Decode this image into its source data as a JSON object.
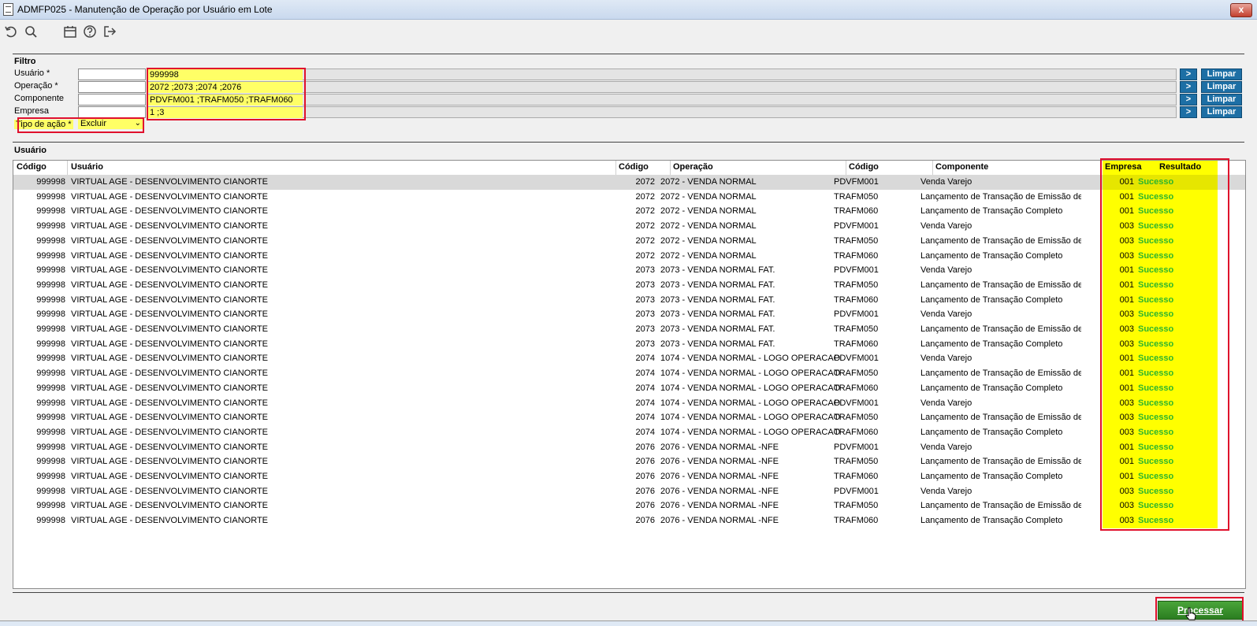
{
  "window": {
    "title": "ADMFP025 - Manutenção de Operação por Usuário em Lote",
    "close_label": "x"
  },
  "toolbar": {
    "icons": [
      "undo-icon",
      "search-icon",
      "calendar-icon",
      "help-icon",
      "exit-icon"
    ]
  },
  "filtro": {
    "section_label": "Filtro",
    "fields": [
      {
        "label": "Usuário *",
        "value": "999998"
      },
      {
        "label": "Operação *",
        "value": "2072 ;2073 ;2074 ;2076"
      },
      {
        "label": "Componente",
        "value": "PDVFM001 ;TRAFM050 ;TRAFM060"
      },
      {
        "label": "Empresa",
        "value": "1 ;3"
      }
    ],
    "arrow_label": ">",
    "limpar_label": "Limpar",
    "tipo_acao": {
      "label": "Tipo de ação *",
      "value": "Excluir"
    }
  },
  "grid": {
    "section_label": "Usuário",
    "headers": [
      "Código",
      "Usuário",
      "Código",
      "Operação",
      "Código",
      "Componente",
      "Empresa",
      "Resultado"
    ],
    "rows": [
      [
        "999998",
        "VIRTUAL AGE - DESENVOLVIMENTO CIANORTE",
        "2072",
        "2072 - VENDA NORMAL",
        "PDVFM001",
        "Venda Varejo",
        "001",
        "Sucesso"
      ],
      [
        "999998",
        "VIRTUAL AGE - DESENVOLVIMENTO CIANORTE",
        "2072",
        "2072 - VENDA NORMAL",
        "TRAFM050",
        "Lançamento de Transação de Emissão de",
        "001",
        "Sucesso"
      ],
      [
        "999998",
        "VIRTUAL AGE - DESENVOLVIMENTO CIANORTE",
        "2072",
        "2072 - VENDA NORMAL",
        "TRAFM060",
        "Lançamento de Transação Completo",
        "001",
        "Sucesso"
      ],
      [
        "999998",
        "VIRTUAL AGE - DESENVOLVIMENTO CIANORTE",
        "2072",
        "2072 - VENDA NORMAL",
        "PDVFM001",
        "Venda Varejo",
        "003",
        "Sucesso"
      ],
      [
        "999998",
        "VIRTUAL AGE - DESENVOLVIMENTO CIANORTE",
        "2072",
        "2072 - VENDA NORMAL",
        "TRAFM050",
        "Lançamento de Transação de Emissão de",
        "003",
        "Sucesso"
      ],
      [
        "999998",
        "VIRTUAL AGE - DESENVOLVIMENTO CIANORTE",
        "2072",
        "2072 - VENDA NORMAL",
        "TRAFM060",
        "Lançamento de Transação Completo",
        "003",
        "Sucesso"
      ],
      [
        "999998",
        "VIRTUAL AGE - DESENVOLVIMENTO CIANORTE",
        "2073",
        "2073 - VENDA NORMAL FAT.",
        "PDVFM001",
        "Venda Varejo",
        "001",
        "Sucesso"
      ],
      [
        "999998",
        "VIRTUAL AGE - DESENVOLVIMENTO CIANORTE",
        "2073",
        "2073 - VENDA NORMAL FAT.",
        "TRAFM050",
        "Lançamento de Transação de Emissão de",
        "001",
        "Sucesso"
      ],
      [
        "999998",
        "VIRTUAL AGE - DESENVOLVIMENTO CIANORTE",
        "2073",
        "2073 - VENDA NORMAL FAT.",
        "TRAFM060",
        "Lançamento de Transação Completo",
        "001",
        "Sucesso"
      ],
      [
        "999998",
        "VIRTUAL AGE - DESENVOLVIMENTO CIANORTE",
        "2073",
        "2073 - VENDA NORMAL FAT.",
        "PDVFM001",
        "Venda Varejo",
        "003",
        "Sucesso"
      ],
      [
        "999998",
        "VIRTUAL AGE - DESENVOLVIMENTO CIANORTE",
        "2073",
        "2073 - VENDA NORMAL FAT.",
        "TRAFM050",
        "Lançamento de Transação de Emissão de",
        "003",
        "Sucesso"
      ],
      [
        "999998",
        "VIRTUAL AGE - DESENVOLVIMENTO CIANORTE",
        "2073",
        "2073 - VENDA NORMAL FAT.",
        "TRAFM060",
        "Lançamento de Transação Completo",
        "003",
        "Sucesso"
      ],
      [
        "999998",
        "VIRTUAL AGE - DESENVOLVIMENTO CIANORTE",
        "2074",
        "1074 - VENDA NORMAL - LOGO OPERACAO",
        "PDVFM001",
        "Venda Varejo",
        "001",
        "Sucesso"
      ],
      [
        "999998",
        "VIRTUAL AGE - DESENVOLVIMENTO CIANORTE",
        "2074",
        "1074 - VENDA NORMAL - LOGO OPERACAO",
        "TRAFM050",
        "Lançamento de Transação de Emissão de",
        "001",
        "Sucesso"
      ],
      [
        "999998",
        "VIRTUAL AGE - DESENVOLVIMENTO CIANORTE",
        "2074",
        "1074 - VENDA NORMAL - LOGO OPERACAO",
        "TRAFM060",
        "Lançamento de Transação Completo",
        "001",
        "Sucesso"
      ],
      [
        "999998",
        "VIRTUAL AGE - DESENVOLVIMENTO CIANORTE",
        "2074",
        "1074 - VENDA NORMAL - LOGO OPERACAO",
        "PDVFM001",
        "Venda Varejo",
        "003",
        "Sucesso"
      ],
      [
        "999998",
        "VIRTUAL AGE - DESENVOLVIMENTO CIANORTE",
        "2074",
        "1074 - VENDA NORMAL - LOGO OPERACAO",
        "TRAFM050",
        "Lançamento de Transação de Emissão de",
        "003",
        "Sucesso"
      ],
      [
        "999998",
        "VIRTUAL AGE - DESENVOLVIMENTO CIANORTE",
        "2074",
        "1074 - VENDA NORMAL - LOGO OPERACAO",
        "TRAFM060",
        "Lançamento de Transação Completo",
        "003",
        "Sucesso"
      ],
      [
        "999998",
        "VIRTUAL AGE - DESENVOLVIMENTO CIANORTE",
        "2076",
        "2076 - VENDA NORMAL -NFE",
        "PDVFM001",
        "Venda Varejo",
        "001",
        "Sucesso"
      ],
      [
        "999998",
        "VIRTUAL AGE - DESENVOLVIMENTO CIANORTE",
        "2076",
        "2076 - VENDA NORMAL -NFE",
        "TRAFM050",
        "Lançamento de Transação de Emissão de",
        "001",
        "Sucesso"
      ],
      [
        "999998",
        "VIRTUAL AGE - DESENVOLVIMENTO CIANORTE",
        "2076",
        "2076 - VENDA NORMAL -NFE",
        "TRAFM060",
        "Lançamento de Transação Completo",
        "001",
        "Sucesso"
      ],
      [
        "999998",
        "VIRTUAL AGE - DESENVOLVIMENTO CIANORTE",
        "2076",
        "2076 - VENDA NORMAL -NFE",
        "PDVFM001",
        "Venda Varejo",
        "003",
        "Sucesso"
      ],
      [
        "999998",
        "VIRTUAL AGE - DESENVOLVIMENTO CIANORTE",
        "2076",
        "2076 - VENDA NORMAL -NFE",
        "TRAFM050",
        "Lançamento de Transação de Emissão de",
        "003",
        "Sucesso"
      ],
      [
        "999998",
        "VIRTUAL AGE - DESENVOLVIMENTO CIANORTE",
        "2076",
        "2076 - VENDA NORMAL -NFE",
        "TRAFM060",
        "Lançamento de Transação Completo",
        "003",
        "Sucesso"
      ]
    ],
    "result_color": "#2db52d"
  },
  "footer": {
    "processar_label": "Processar"
  },
  "colors": {
    "highlight": "#ffff00",
    "annotation": "#e0102c",
    "button": "#1d6fa5"
  }
}
